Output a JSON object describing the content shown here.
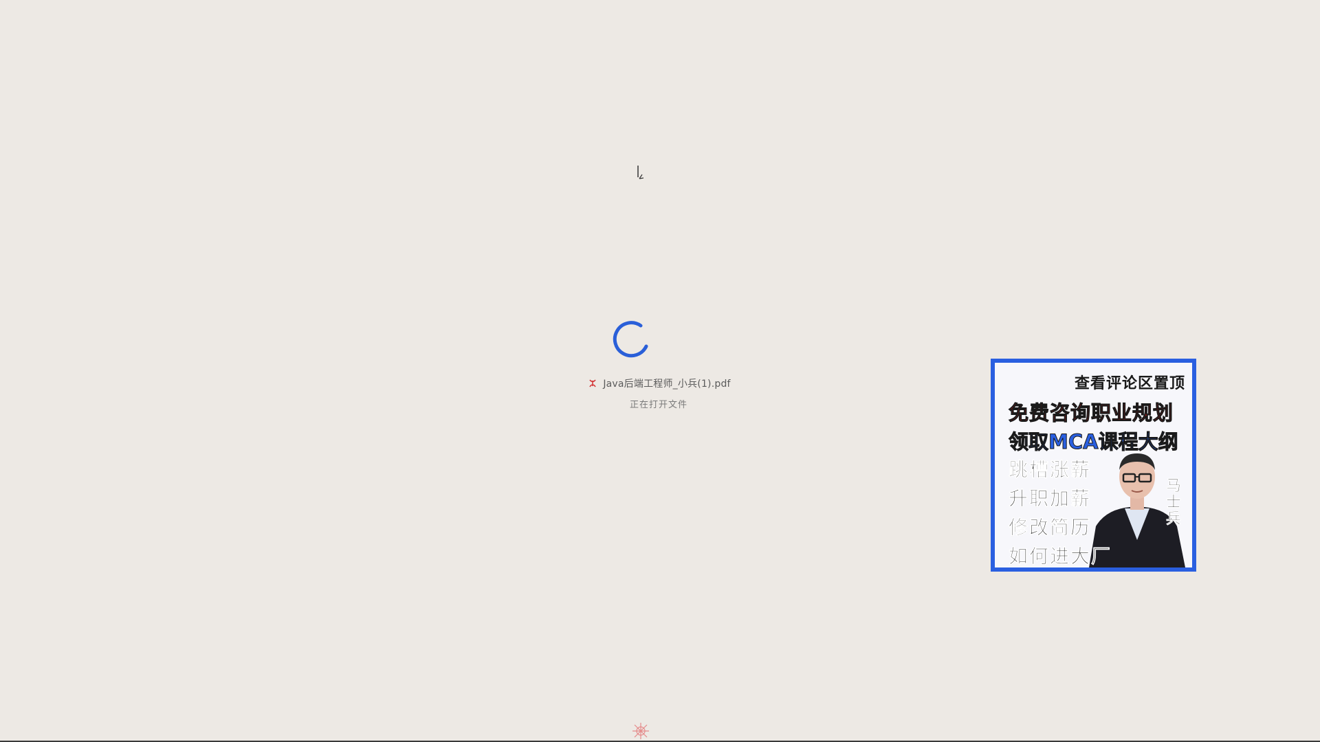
{
  "loading": {
    "file_name": "Java后端工程师_小兵(1).pdf",
    "status": "正在打开文件"
  },
  "ad": {
    "line1": "查看评论区置顶",
    "line2": "免费咨询职业规划",
    "line3": "领取MCA课程大纲",
    "items": [
      "跳槽涨薪",
      "升职加薪",
      "修改简历",
      "如何进大厂"
    ],
    "person_name": "马士兵",
    "colors": {
      "border": "#2a5fe0",
      "highlight_red": "#e01212",
      "highlight_blue": "#2a5fe0"
    }
  },
  "icons": {
    "spinner": "loading-spinner-icon",
    "pdf": "pdf-file-icon",
    "cursor": "text-cursor-icon",
    "emblem": "watermark-emblem-icon"
  },
  "colors": {
    "background": "#ede9e4",
    "spinner": "#2a5fd8"
  }
}
